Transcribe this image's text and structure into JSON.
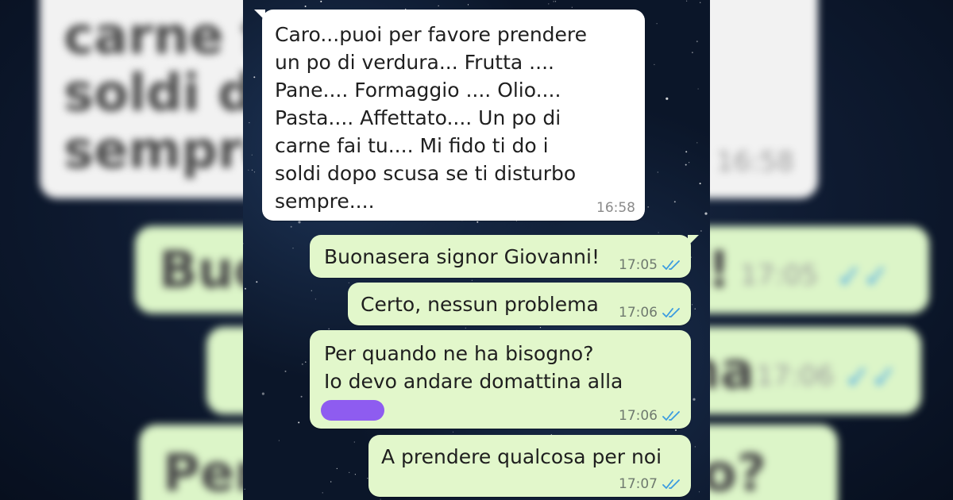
{
  "colors": {
    "incoming_bubble": "#ffffff",
    "outgoing_bubble": "#e2f7cb",
    "read_ticks": "#3a9be0",
    "background": "#0b1629",
    "redaction": "#8e5cf0"
  },
  "chat": {
    "messages": [
      {
        "direction": "incoming",
        "text": "Caro...puoi per favore prendere\nun po di verdura... Frutta ....\nPane.... Formaggio .... Olio....\nPasta.... Affettato.... Un po di\ncarne fai tu.... Mi fido ti do i\nsoldi dopo scusa se ti disturbo\nsempre....",
        "time": "16:58"
      },
      {
        "direction": "outgoing",
        "text": "Buonasera signor Giovanni!",
        "time": "17:05",
        "status_icon": "double-check-read-icon"
      },
      {
        "direction": "outgoing",
        "text": "Certo, nessun problema",
        "time": "17:06",
        "status_icon": "double-check-read-icon"
      },
      {
        "direction": "outgoing",
        "text": "Per quando ne ha bisogno?\nIo devo andare domattina alla",
        "time": "17:06",
        "status_icon": "double-check-read-icon",
        "redacted": true
      },
      {
        "direction": "outgoing",
        "text": "A prendere qualcosa per noi",
        "time": "17:07",
        "status_icon": "double-check-read-icon"
      }
    ]
  },
  "background_blur": {
    "fragments": [
      "carne fa",
      "soldi do",
      "sempre",
      "Buo",
      "ni!",
      "na",
      "Per",
      "o?"
    ],
    "times": [
      "16:58",
      "17:05",
      "17:06"
    ]
  }
}
